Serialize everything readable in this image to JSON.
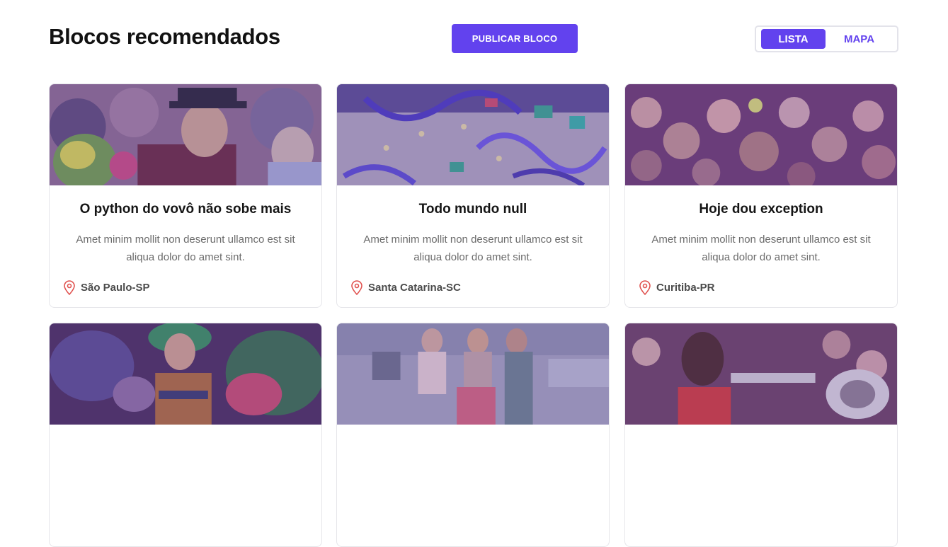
{
  "header": {
    "title": "Blocos recomendados",
    "publish_label": "PUBLICAR BLOCO",
    "view_toggle": {
      "active": "LISTA",
      "inactive": "MAPA"
    }
  },
  "colors": {
    "accent": "#6242ee",
    "pin": "#e0524f",
    "image_tint": "#6b4fd6"
  },
  "cards": [
    {
      "title": "O python do vovô não sobe mais",
      "description": "Amet minim mollit non deserunt ullamco est sit aliqua dolor do amet sint.",
      "location": "São Paulo-SP",
      "icon": "location-pin-icon",
      "image": "carnival-man-top-hat-photo"
    },
    {
      "title": "Todo mundo null",
      "description": "Amet minim mollit non deserunt ullamco est sit aliqua dolor do amet sint.",
      "location": "Santa Catarina-SC",
      "icon": "location-pin-icon",
      "image": "confetti-streamers-photo"
    },
    {
      "title": "Hoje dou exception",
      "description": "Amet minim mollit non deserunt ullamco est sit aliqua dolor do amet sint.",
      "location": "Curitiba-PR",
      "icon": "location-pin-icon",
      "image": "street-crowd-photo"
    },
    {
      "image": "costumed-dancer-photo"
    },
    {
      "image": "street-dancers-photo"
    },
    {
      "image": "trumpet-player-photo"
    }
  ]
}
